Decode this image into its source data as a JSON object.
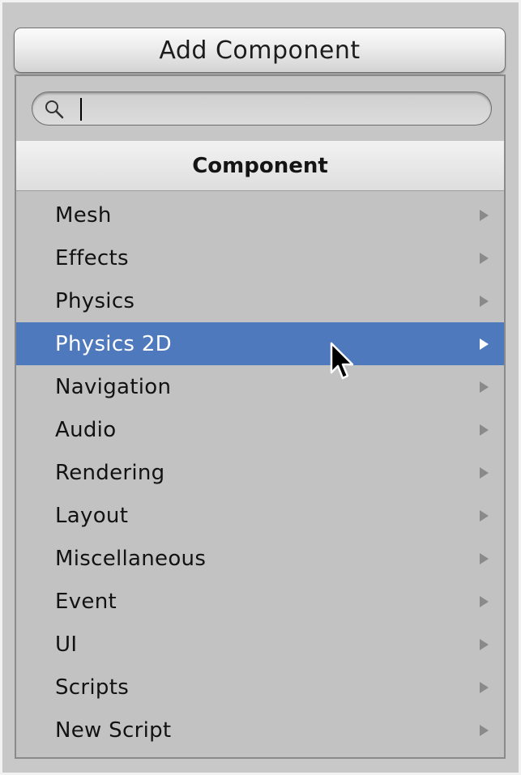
{
  "add_component": {
    "label": "Add Component"
  },
  "search": {
    "value": "",
    "placeholder": ""
  },
  "header": {
    "title": "Component"
  },
  "menu": {
    "items": [
      {
        "label": "Mesh",
        "selected": false
      },
      {
        "label": "Effects",
        "selected": false
      },
      {
        "label": "Physics",
        "selected": false
      },
      {
        "label": "Physics 2D",
        "selected": true
      },
      {
        "label": "Navigation",
        "selected": false
      },
      {
        "label": "Audio",
        "selected": false
      },
      {
        "label": "Rendering",
        "selected": false
      },
      {
        "label": "Layout",
        "selected": false
      },
      {
        "label": "Miscellaneous",
        "selected": false
      },
      {
        "label": "Event",
        "selected": false
      },
      {
        "label": "UI",
        "selected": false
      },
      {
        "label": "Scripts",
        "selected": false
      },
      {
        "label": "New Script",
        "selected": false
      }
    ]
  },
  "colors": {
    "selection": "#4f79bd",
    "background": "#c2c2c2"
  },
  "icons": {
    "search": "search-icon",
    "submenu": "submenu-arrow-icon",
    "cursor": "mouse-pointer-icon"
  }
}
